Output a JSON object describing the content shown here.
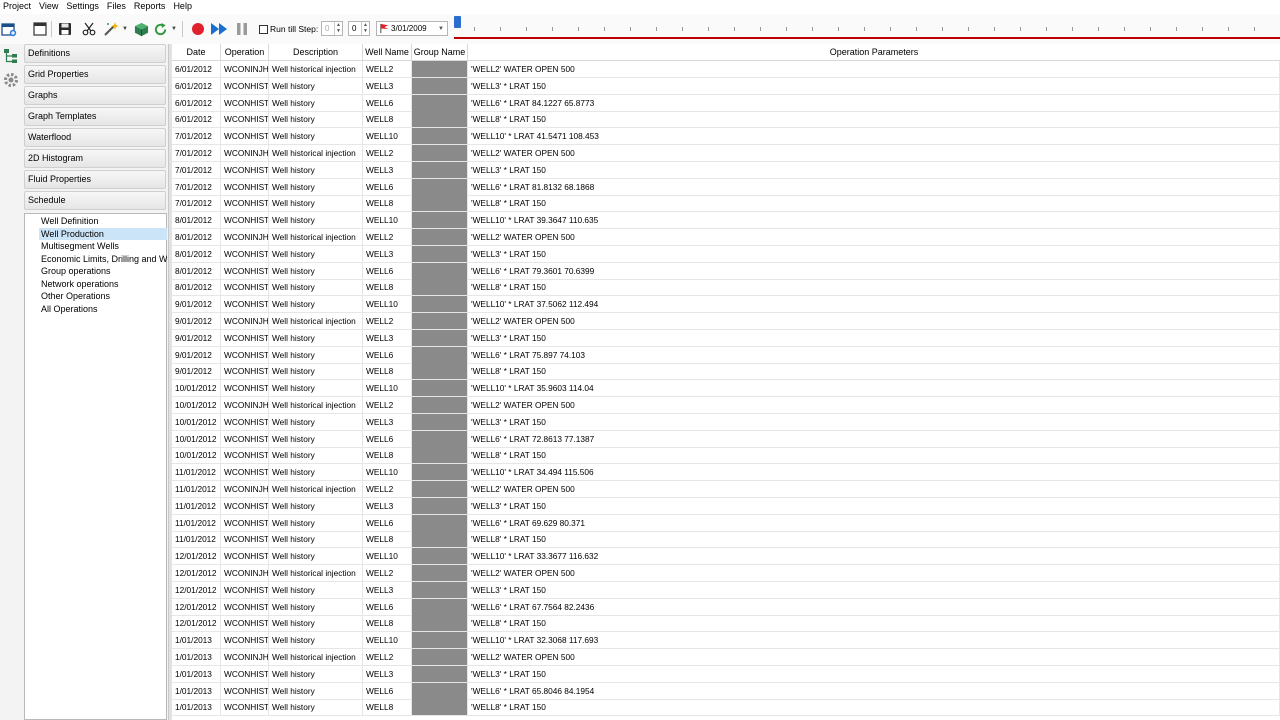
{
  "menu": [
    "Project",
    "View",
    "Settings",
    "Files",
    "Reports",
    "Help"
  ],
  "toolbar": {
    "run_till_step_label": "Run till Step:",
    "step_from": "0",
    "step_to": "0",
    "date_value": "3/01/2009",
    "record_color": "#e0202a",
    "play_color": "#1a6fd0"
  },
  "sidebar": {
    "sections": [
      "Definitions",
      "Grid Properties",
      "Graphs",
      "Graph Templates",
      "Waterflood",
      "2D Histogram",
      "Fluid Properties",
      "Schedule"
    ],
    "tree": [
      "Well Definition",
      "Well Production",
      "Multisegment Wells",
      "Economic Limits, Drilling and Workover",
      "Group operations",
      "Network operations",
      "Other Operations",
      "All Operations"
    ],
    "selected_index": 1
  },
  "table": {
    "columns": [
      "Date",
      "Operation",
      "Description",
      "Well Name",
      "Group Name",
      "Operation Parameters"
    ],
    "rows": [
      [
        "6/01/2012",
        "WCONINJH",
        "Well historical injection",
        "WELL2",
        "",
        "'WELL2' WATER OPEN 500"
      ],
      [
        "6/01/2012",
        "WCONHIST",
        "Well history",
        "WELL3",
        "",
        "'WELL3' * LRAT 150"
      ],
      [
        "6/01/2012",
        "WCONHIST",
        "Well history",
        "WELL6",
        "",
        "'WELL6' * LRAT 84.1227 65.8773"
      ],
      [
        "6/01/2012",
        "WCONHIST",
        "Well history",
        "WELL8",
        "",
        "'WELL8' * LRAT 150"
      ],
      [
        "7/01/2012",
        "WCONHIST",
        "Well history",
        "WELL10",
        "",
        "'WELL10' * LRAT 41.5471 108.453"
      ],
      [
        "7/01/2012",
        "WCONINJH",
        "Well historical injection",
        "WELL2",
        "",
        "'WELL2' WATER OPEN 500"
      ],
      [
        "7/01/2012",
        "WCONHIST",
        "Well history",
        "WELL3",
        "",
        "'WELL3' * LRAT 150"
      ],
      [
        "7/01/2012",
        "WCONHIST",
        "Well history",
        "WELL6",
        "",
        "'WELL6' * LRAT 81.8132 68.1868"
      ],
      [
        "7/01/2012",
        "WCONHIST",
        "Well history",
        "WELL8",
        "",
        "'WELL8' * LRAT 150"
      ],
      [
        "8/01/2012",
        "WCONHIST",
        "Well history",
        "WELL10",
        "",
        "'WELL10' * LRAT 39.3647 110.635"
      ],
      [
        "8/01/2012",
        "WCONINJH",
        "Well historical injection",
        "WELL2",
        "",
        "'WELL2' WATER OPEN 500"
      ],
      [
        "8/01/2012",
        "WCONHIST",
        "Well history",
        "WELL3",
        "",
        "'WELL3' * LRAT 150"
      ],
      [
        "8/01/2012",
        "WCONHIST",
        "Well history",
        "WELL6",
        "",
        "'WELL6' * LRAT 79.3601 70.6399"
      ],
      [
        "8/01/2012",
        "WCONHIST",
        "Well history",
        "WELL8",
        "",
        "'WELL8' * LRAT 150"
      ],
      [
        "9/01/2012",
        "WCONHIST",
        "Well history",
        "WELL10",
        "",
        "'WELL10' * LRAT 37.5062 112.494"
      ],
      [
        "9/01/2012",
        "WCONINJH",
        "Well historical injection",
        "WELL2",
        "",
        "'WELL2' WATER OPEN 500"
      ],
      [
        "9/01/2012",
        "WCONHIST",
        "Well history",
        "WELL3",
        "",
        "'WELL3' * LRAT 150"
      ],
      [
        "9/01/2012",
        "WCONHIST",
        "Well history",
        "WELL6",
        "",
        "'WELL6' * LRAT 75.897 74.103"
      ],
      [
        "9/01/2012",
        "WCONHIST",
        "Well history",
        "WELL8",
        "",
        "'WELL8' * LRAT 150"
      ],
      [
        "10/01/2012",
        "WCONHIST",
        "Well history",
        "WELL10",
        "",
        "'WELL10' * LRAT 35.9603 114.04"
      ],
      [
        "10/01/2012",
        "WCONINJH",
        "Well historical injection",
        "WELL2",
        "",
        "'WELL2' WATER OPEN 500"
      ],
      [
        "10/01/2012",
        "WCONHIST",
        "Well history",
        "WELL3",
        "",
        "'WELL3' * LRAT 150"
      ],
      [
        "10/01/2012",
        "WCONHIST",
        "Well history",
        "WELL6",
        "",
        "'WELL6' * LRAT 72.8613 77.1387"
      ],
      [
        "10/01/2012",
        "WCONHIST",
        "Well history",
        "WELL8",
        "",
        "'WELL8' * LRAT 150"
      ],
      [
        "11/01/2012",
        "WCONHIST",
        "Well history",
        "WELL10",
        "",
        "'WELL10' * LRAT 34.494 115.506"
      ],
      [
        "11/01/2012",
        "WCONINJH",
        "Well historical injection",
        "WELL2",
        "",
        "'WELL2' WATER OPEN 500"
      ],
      [
        "11/01/2012",
        "WCONHIST",
        "Well history",
        "WELL3",
        "",
        "'WELL3' * LRAT 150"
      ],
      [
        "11/01/2012",
        "WCONHIST",
        "Well history",
        "WELL6",
        "",
        "'WELL6' * LRAT 69.629 80.371"
      ],
      [
        "11/01/2012",
        "WCONHIST",
        "Well history",
        "WELL8",
        "",
        "'WELL8' * LRAT 150"
      ],
      [
        "12/01/2012",
        "WCONHIST",
        "Well history",
        "WELL10",
        "",
        "'WELL10' * LRAT 33.3677 116.632"
      ],
      [
        "12/01/2012",
        "WCONINJH",
        "Well historical injection",
        "WELL2",
        "",
        "'WELL2' WATER OPEN 500"
      ],
      [
        "12/01/2012",
        "WCONHIST",
        "Well history",
        "WELL3",
        "",
        "'WELL3' * LRAT 150"
      ],
      [
        "12/01/2012",
        "WCONHIST",
        "Well history",
        "WELL6",
        "",
        "'WELL6' * LRAT 67.7564 82.2436"
      ],
      [
        "12/01/2012",
        "WCONHIST",
        "Well history",
        "WELL8",
        "",
        "'WELL8' * LRAT 150"
      ],
      [
        "1/01/2013",
        "WCONHIST",
        "Well history",
        "WELL10",
        "",
        "'WELL10' * LRAT 32.3068 117.693"
      ],
      [
        "1/01/2013",
        "WCONINJH",
        "Well historical injection",
        "WELL2",
        "",
        "'WELL2' WATER OPEN 500"
      ],
      [
        "1/01/2013",
        "WCONHIST",
        "Well history",
        "WELL3",
        "",
        "'WELL3' * LRAT 150"
      ],
      [
        "1/01/2013",
        "WCONHIST",
        "Well history",
        "WELL6",
        "",
        "'WELL6' * LRAT 65.8046 84.1954"
      ],
      [
        "1/01/2013",
        "WCONHIST",
        "Well history",
        "WELL8",
        "",
        "'WELL8' * LRAT 150"
      ]
    ]
  }
}
